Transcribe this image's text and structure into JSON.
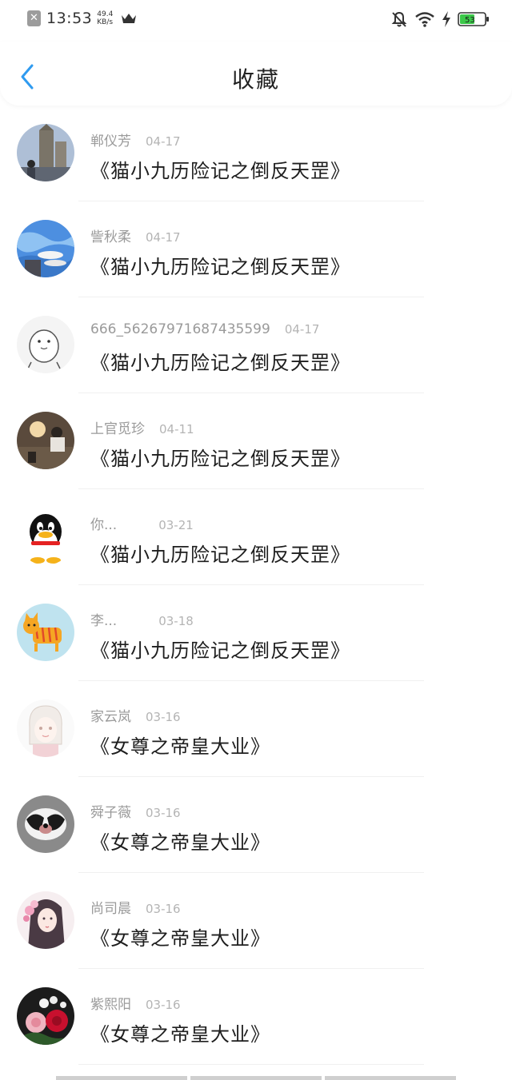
{
  "status_bar": {
    "time": "13:53",
    "net_speed_value": "49.4",
    "net_speed_unit": "KB/s",
    "battery_level": "53",
    "icons": [
      "close-notification-icon",
      "crown-icon",
      "mute-bell-icon",
      "wifi-icon",
      "charging-bolt-icon",
      "battery-icon"
    ]
  },
  "header": {
    "title": "收藏",
    "back_icon": "chevron-left-icon"
  },
  "items": [
    {
      "name": "郸仪芳",
      "date": "04-17",
      "book": "《猫小九历险记之倒反天罡》"
    },
    {
      "name": "訾秋柔",
      "date": "04-17",
      "book": "《猫小九历险记之倒反天罡》"
    },
    {
      "name": "666_56267971687435599",
      "date": "04-17",
      "book": "《猫小九历险记之倒反天罡》"
    },
    {
      "name": "上官觅珍",
      "date": "04-11",
      "book": "《猫小九历险记之倒反天罡》"
    },
    {
      "name": "你...",
      "date": "03-21",
      "book": "《猫小九历险记之倒反天罡》"
    },
    {
      "name": "李...",
      "date": "03-18",
      "book": "《猫小九历险记之倒反天罡》"
    },
    {
      "name": "家云岚",
      "date": "03-16",
      "book": "《女尊之帝皇大业》"
    },
    {
      "name": "舜子薇",
      "date": "03-16",
      "book": "《女尊之帝皇大业》"
    },
    {
      "name": "尚司晨",
      "date": "03-16",
      "book": "《女尊之帝皇大业》"
    },
    {
      "name": "紫熙阳",
      "date": "03-16",
      "book": "《女尊之帝皇大业》"
    }
  ],
  "colors": {
    "accent_blue": "#2f9bf0",
    "battery_green": "#3cc84a"
  }
}
